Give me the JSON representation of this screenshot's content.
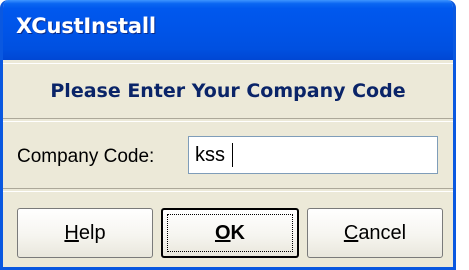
{
  "window": {
    "title": "XCustInstall"
  },
  "prompt": {
    "heading": "Please Enter Your Company Code"
  },
  "field": {
    "label": "Company Code:",
    "value": "kss",
    "placeholder": ""
  },
  "buttons": {
    "help": {
      "mnemonic": "H",
      "rest": "elp"
    },
    "ok": {
      "mnemonic": "O",
      "rest": "K"
    },
    "cancel": {
      "mnemonic": "C",
      "rest": "ancel"
    }
  },
  "colors": {
    "titlebar": "#0054e8",
    "title_text": "#ffffff",
    "heading_text": "#0a2468",
    "dialog_bg": "#ece9d8",
    "window_border": "#0a58e0"
  }
}
